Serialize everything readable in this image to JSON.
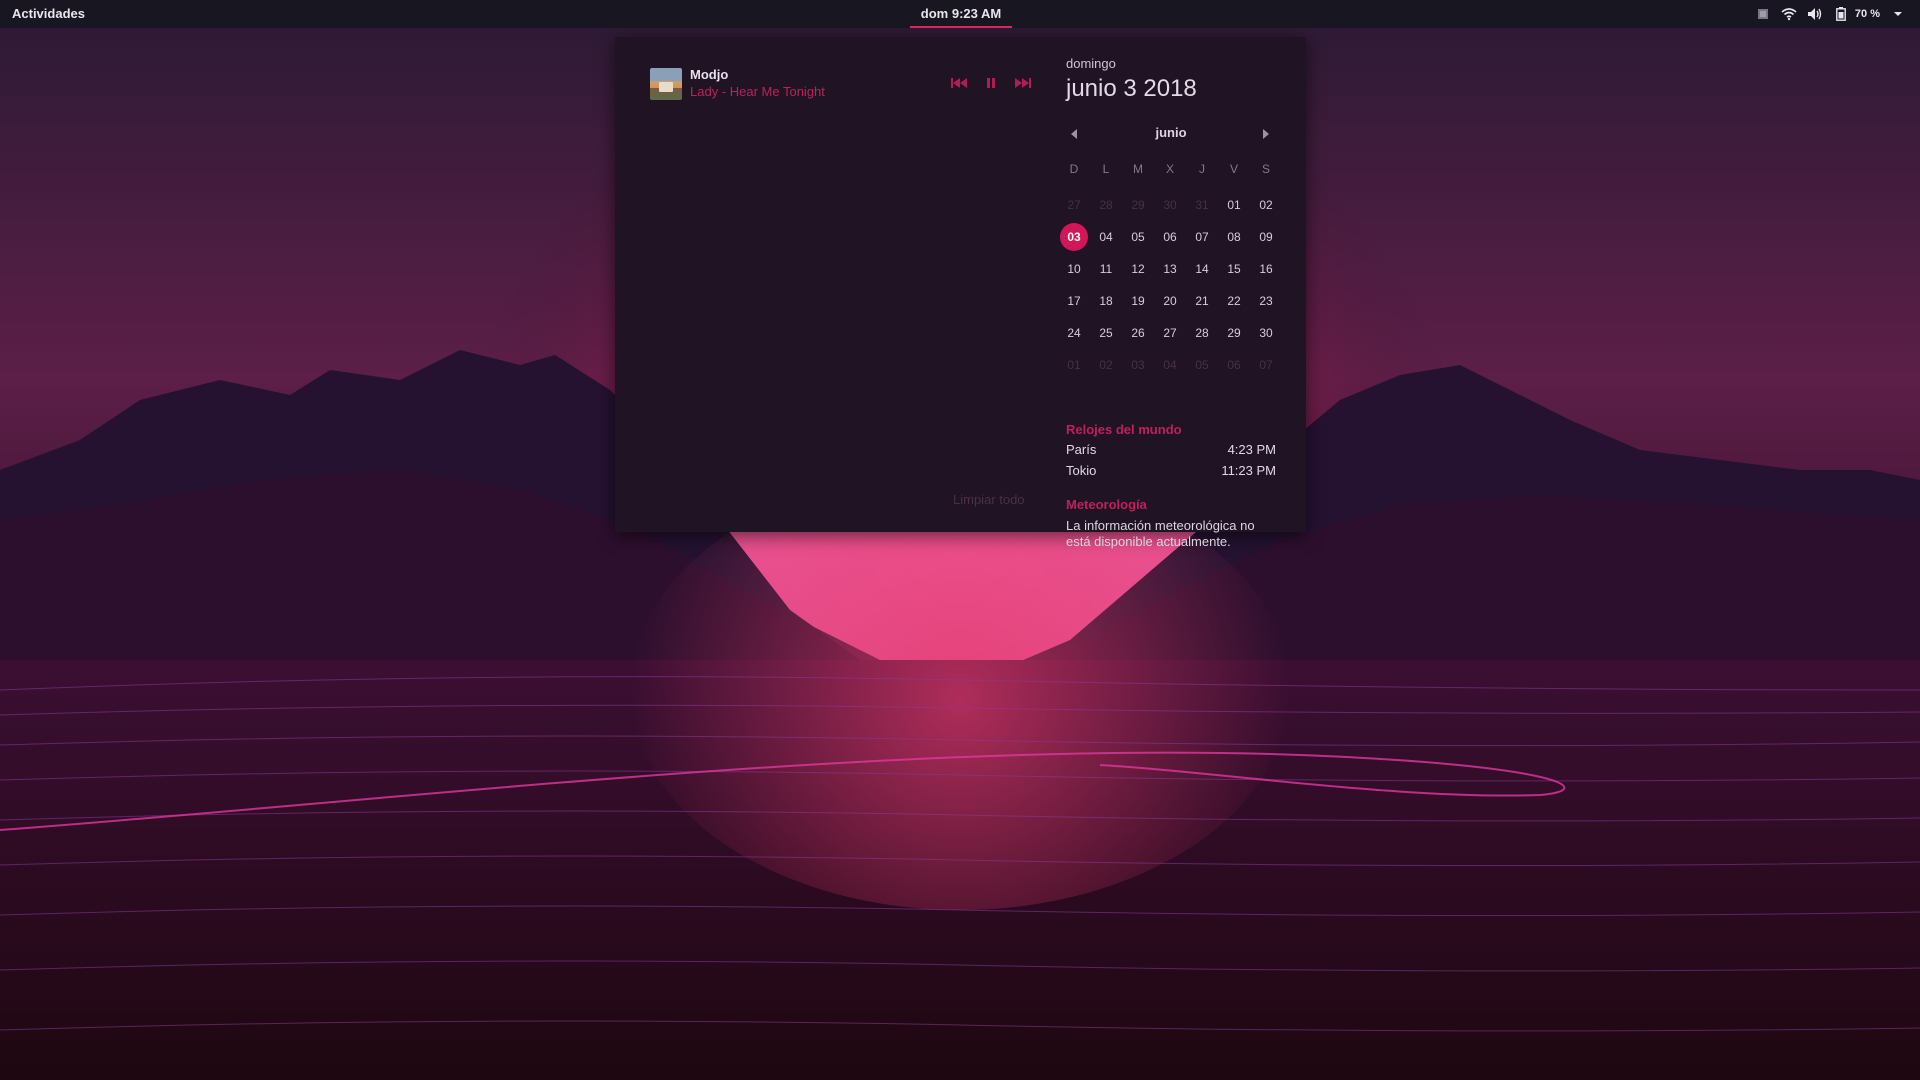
{
  "topbar": {
    "activities": "Actividades",
    "clock": "dom  9:23 AM",
    "battery": "70 %",
    "icons": [
      "overview-app-icon",
      "wifi-icon",
      "volume-icon",
      "battery-icon",
      "chevron-down-icon"
    ]
  },
  "media": {
    "artist": "Modjo",
    "track": "Lady - Hear Me Tonight",
    "controls": [
      "previous-icon",
      "pause-icon",
      "next-icon"
    ]
  },
  "notifications": {
    "clear_all": "Limpiar todo"
  },
  "date": {
    "weekday": "domingo",
    "full": "junio  3 2018"
  },
  "calendar": {
    "month": "junio",
    "weekdays": [
      "D",
      "L",
      "M",
      "X",
      "J",
      "V",
      "S"
    ],
    "weeks": [
      [
        "27",
        "28",
        "29",
        "30",
        "31",
        "01",
        "02"
      ],
      [
        "03",
        "04",
        "05",
        "06",
        "07",
        "08",
        "09"
      ],
      [
        "10",
        "11",
        "12",
        "13",
        "14",
        "15",
        "16"
      ],
      [
        "17",
        "18",
        "19",
        "20",
        "21",
        "22",
        "23"
      ],
      [
        "24",
        "25",
        "26",
        "27",
        "28",
        "29",
        "30"
      ],
      [
        "01",
        "02",
        "03",
        "04",
        "05",
        "06",
        "07"
      ]
    ],
    "today": "03"
  },
  "world_clocks": {
    "title": "Relojes del mundo",
    "items": [
      {
        "city": "París",
        "time": "4:23 PM"
      },
      {
        "city": "Tokio",
        "time": "11:23 PM"
      }
    ]
  },
  "weather": {
    "title": "Meteorología",
    "message_line1": "La información meteorológica no",
    "message_line2": "está disponible actualmente."
  },
  "colors": {
    "accent": "#d1175a",
    "popover_bg": "#1f1324",
    "topbar_bg": "#181621"
  }
}
